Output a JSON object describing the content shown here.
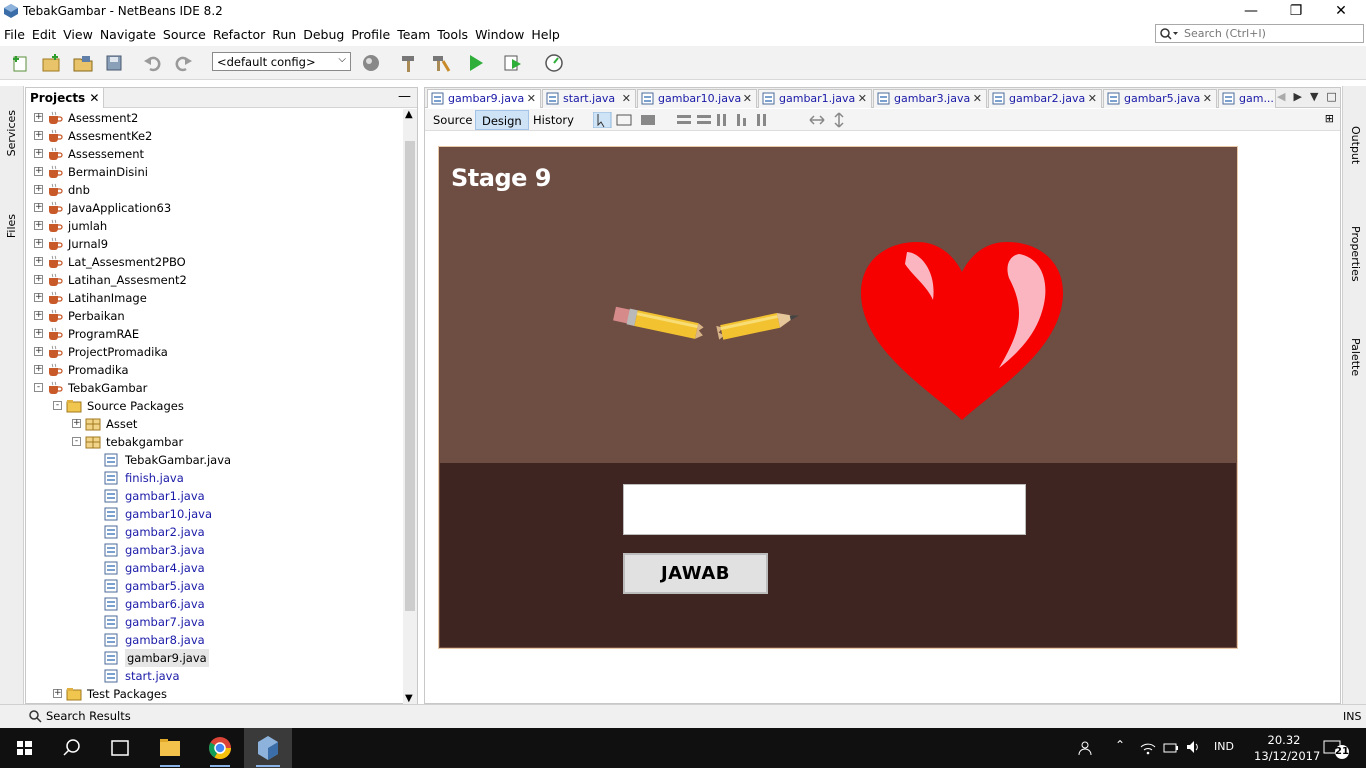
{
  "window": {
    "title": "TebakGambar - NetBeans IDE 8.2"
  },
  "menu": [
    "File",
    "Edit",
    "View",
    "Navigate",
    "Source",
    "Refactor",
    "Run",
    "Debug",
    "Profile",
    "Team",
    "Tools",
    "Window",
    "Help"
  ],
  "search": {
    "placeholder": "Search (Ctrl+I)"
  },
  "toolbar": {
    "config": "<default config>"
  },
  "left_strip": {
    "services": "Services",
    "files": "Files"
  },
  "right_strip": {
    "output": "Output",
    "properties": "Properties",
    "palette": "Palette"
  },
  "projects": {
    "tab": "Projects",
    "items": [
      {
        "label": "Asessment2",
        "level": 0,
        "type": "project",
        "expand": "+"
      },
      {
        "label": "AssesmentKe2",
        "level": 0,
        "type": "project",
        "expand": "+"
      },
      {
        "label": "Assessement",
        "level": 0,
        "type": "project",
        "expand": "+"
      },
      {
        "label": "BermainDisini",
        "level": 0,
        "type": "project",
        "expand": "+"
      },
      {
        "label": "dnb",
        "level": 0,
        "type": "project",
        "expand": "+"
      },
      {
        "label": "JavaApplication63",
        "level": 0,
        "type": "project",
        "expand": "+"
      },
      {
        "label": "jumlah",
        "level": 0,
        "type": "project",
        "expand": "+"
      },
      {
        "label": "Jurnal9",
        "level": 0,
        "type": "project",
        "expand": "+"
      },
      {
        "label": "Lat_Assesment2PBO",
        "level": 0,
        "type": "project",
        "expand": "+"
      },
      {
        "label": "Latihan_Assesment2",
        "level": 0,
        "type": "project",
        "expand": "+"
      },
      {
        "label": "LatihanImage",
        "level": 0,
        "type": "project",
        "expand": "+"
      },
      {
        "label": "Perbaikan",
        "level": 0,
        "type": "project",
        "expand": "+"
      },
      {
        "label": "ProgramRAE",
        "level": 0,
        "type": "project",
        "expand": "+"
      },
      {
        "label": "ProjectPromadika",
        "level": 0,
        "type": "project",
        "expand": "+"
      },
      {
        "label": "Promadika",
        "level": 0,
        "type": "project",
        "expand": "+"
      },
      {
        "label": "TebakGambar",
        "level": 0,
        "type": "project",
        "expand": "-"
      },
      {
        "label": "Source Packages",
        "level": 1,
        "type": "folder",
        "expand": "-"
      },
      {
        "label": "Asset",
        "level": 2,
        "type": "package",
        "expand": "+"
      },
      {
        "label": "tebakgambar",
        "level": 2,
        "type": "package",
        "expand": "-"
      },
      {
        "label": "TebakGambar.java",
        "level": 3,
        "type": "java",
        "expand": ""
      },
      {
        "label": "finish.java",
        "level": 3,
        "type": "java",
        "expand": "",
        "blue": true
      },
      {
        "label": "gambar1.java",
        "level": 3,
        "type": "java",
        "expand": "",
        "blue": true
      },
      {
        "label": "gambar10.java",
        "level": 3,
        "type": "java",
        "expand": "",
        "blue": true
      },
      {
        "label": "gambar2.java",
        "level": 3,
        "type": "java",
        "expand": "",
        "blue": true
      },
      {
        "label": "gambar3.java",
        "level": 3,
        "type": "java",
        "expand": "",
        "blue": true
      },
      {
        "label": "gambar4.java",
        "level": 3,
        "type": "java",
        "expand": "",
        "blue": true
      },
      {
        "label": "gambar5.java",
        "level": 3,
        "type": "java",
        "expand": "",
        "blue": true
      },
      {
        "label": "gambar6.java",
        "level": 3,
        "type": "java",
        "expand": "",
        "blue": true
      },
      {
        "label": "gambar7.java",
        "level": 3,
        "type": "java",
        "expand": "",
        "blue": true
      },
      {
        "label": "gambar8.java",
        "level": 3,
        "type": "java",
        "expand": "",
        "blue": true
      },
      {
        "label": "gambar9.java",
        "level": 3,
        "type": "java",
        "expand": "",
        "selected": true
      },
      {
        "label": "start.java",
        "level": 3,
        "type": "java",
        "expand": "",
        "blue": true
      },
      {
        "label": "Test Packages",
        "level": 1,
        "type": "folder",
        "expand": "+"
      }
    ]
  },
  "editor": {
    "tabs": [
      "gambar9.java",
      "start.java",
      "gambar10.java",
      "gambar1.java",
      "gambar3.java",
      "gambar2.java",
      "gambar5.java",
      "gam..."
    ],
    "views": [
      "Source",
      "Design",
      "History"
    ],
    "active_view": "Design",
    "design": {
      "stage_title": "Stage 9",
      "answer_value": "",
      "button_label": "JAWAB"
    }
  },
  "status": {
    "search_results": "Search Results",
    "mode": "INS"
  },
  "taskbar": {
    "lang": "IND",
    "time": "20.32",
    "date": "13/12/2017",
    "notifications": "21"
  }
}
